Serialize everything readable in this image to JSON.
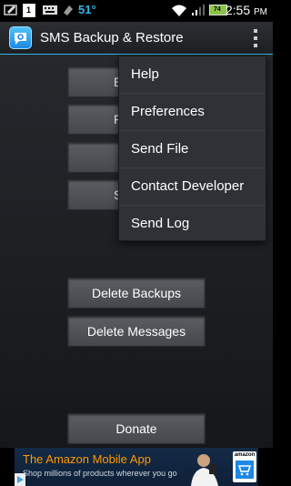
{
  "status_bar": {
    "temperature": "51°",
    "time": "2:55",
    "ampm": "PM",
    "calendar_day": "1",
    "battery_percent": "74",
    "accent_color": "#33b5e5"
  },
  "action_bar": {
    "title": "SMS Backup & Restore",
    "app_icon": "speech-bubble-icon",
    "overflow_icon": "overflow-menu-icon"
  },
  "main_buttons": {
    "hidden_1_partial": "E",
    "hidden_2_partial": "F",
    "hidden_4_partial": "S",
    "delete_backups": "Delete Backups",
    "delete_messages": "Delete Messages",
    "donate": "Donate"
  },
  "overflow_menu": {
    "items": [
      "Help",
      "Preferences",
      "Send File",
      "Contact Developer",
      "Send Log"
    ]
  },
  "ad": {
    "title": "The Amazon Mobile App",
    "subtitle": "Shop millions of products wherever you go",
    "brand": "amazon",
    "brand_color": "#ff9900"
  }
}
